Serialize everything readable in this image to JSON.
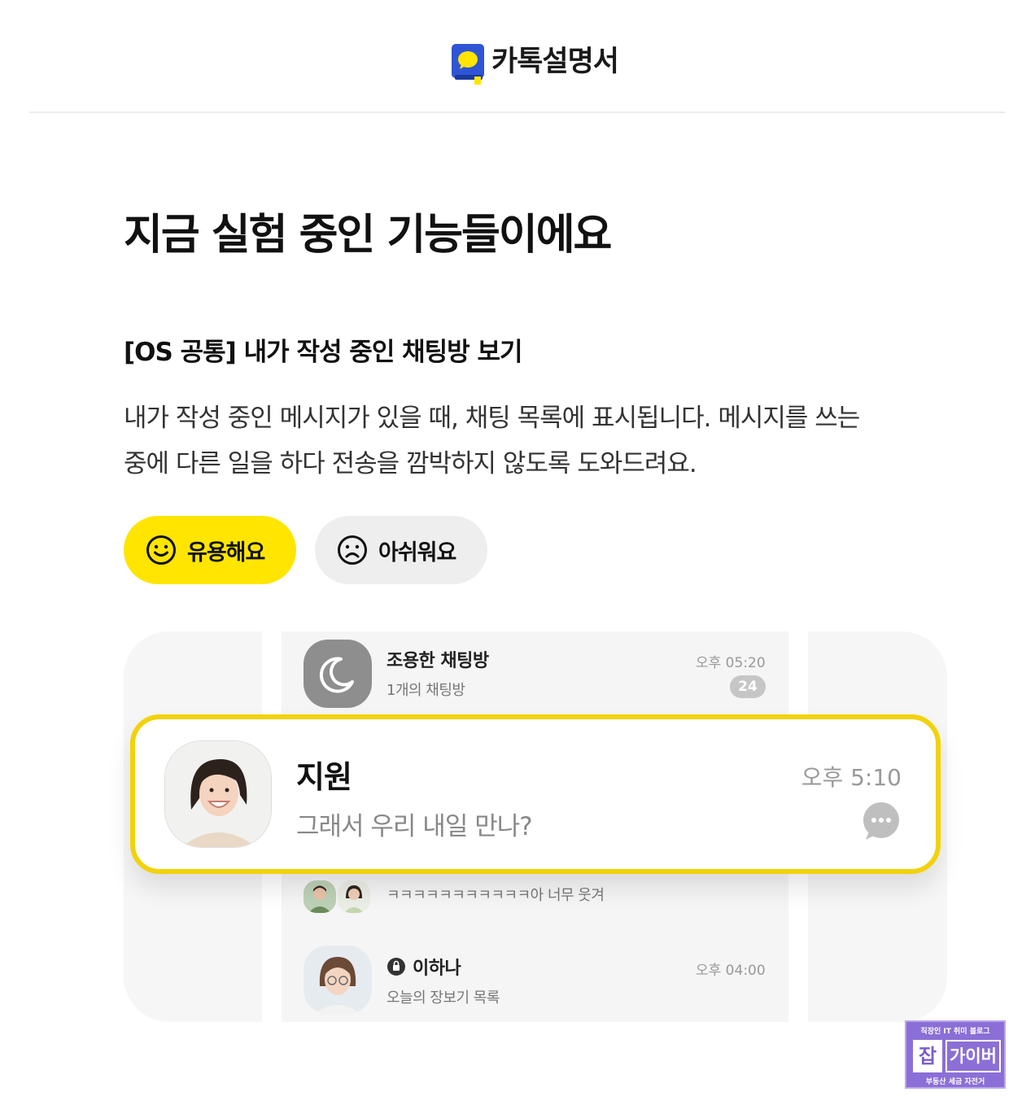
{
  "header": {
    "brand": "카톡설명서"
  },
  "page": {
    "title": "지금 실험 중인 기능들이에요"
  },
  "feature": {
    "title": "[OS 공통] 내가 작성 중인 채팅방 보기",
    "description_line1": "내가 작성 중인 메시지가 있을 때, 채팅 목록에 표시됩니다. 메시지를 쓰는",
    "description_line2": "중에 다른 일을 하다 전송을 깜박하지 않도록 도와드려요.",
    "useful_label": "유용해요",
    "sorry_label": "아쉬워요"
  },
  "preview": {
    "quiet_room": {
      "name": "조용한 채팅방",
      "sub": "1개의 채팅방",
      "time": "오후 05:20",
      "badge": "24"
    },
    "highlight": {
      "name": "지원",
      "message": "그래서 우리 내일 만나?",
      "time": "오후 5:10"
    },
    "group_row": {
      "message": "ㅋㅋㅋㅋㅋㅋㅋㅋㅋㅋㅋ아 너무 웃겨"
    },
    "lee_row": {
      "name": "이하나",
      "sub": "오늘의 장보기 목록",
      "time": "오후 04:00"
    }
  },
  "watermark": {
    "top": "직장인 IT 취미 블로그",
    "jap": "잡",
    "name": "가이버",
    "bottom": "부동산 세금 자전거"
  },
  "colors": {
    "accent_yellow": "#ffe500",
    "highlight_border": "#f2d20a",
    "watermark_purple": "#8b6fd6"
  },
  "icons": {
    "logo": "kakao-book-logo-icon",
    "useful": "smile-face-icon",
    "sorry": "sad-face-icon",
    "quiet_room": "moon-icon",
    "typing": "typing-bubble-icon",
    "lee_badge": "lock-circle-icon"
  }
}
